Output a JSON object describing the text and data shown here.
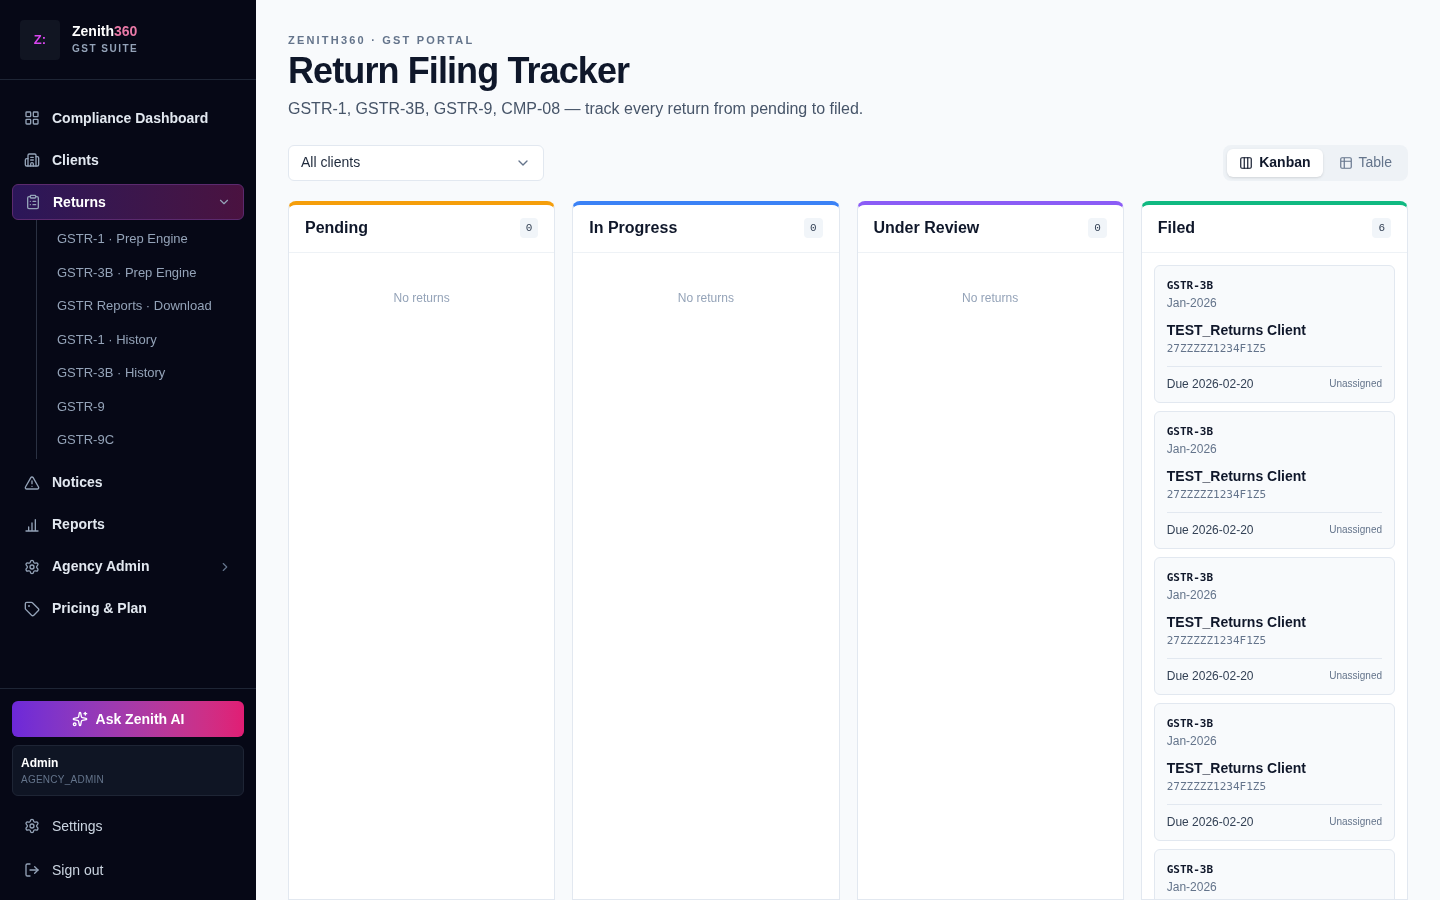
{
  "brand": {
    "logo": "Z:",
    "name": "Zenith",
    "name_accent": "360",
    "tagline": "GST SUITE"
  },
  "nav": [
    {
      "label": "Compliance Dashboard",
      "selected": false
    },
    {
      "label": "Clients",
      "selected": false
    },
    {
      "label": "Returns",
      "selected": true,
      "expanded": true,
      "children": [
        {
          "label": "GSTR-1 · Prep Engine"
        },
        {
          "label": "GSTR-3B · Prep Engine"
        },
        {
          "label": "GSTR Reports · Download"
        },
        {
          "label": "GSTR-1 · History"
        },
        {
          "label": "GSTR-3B · History"
        },
        {
          "label": "GSTR-9"
        },
        {
          "label": "GSTR-9C"
        }
      ]
    },
    {
      "label": "Notices",
      "selected": false
    },
    {
      "label": "Reports",
      "selected": false
    },
    {
      "label": "Agency Admin",
      "selected": false,
      "expanded": false
    },
    {
      "label": "Pricing & Plan",
      "selected": false
    }
  ],
  "ai_button": "Ask Zenith AI",
  "user": {
    "name": "Admin",
    "role": "AGENCY_ADMIN"
  },
  "footer_links": [
    {
      "label": "Settings"
    },
    {
      "label": "Sign out"
    }
  ],
  "header": {
    "eyebrow": "ZENITH360 · GST PORTAL",
    "title": "Return Filing Tracker",
    "subtitle": "GSTR-1, GSTR-3B, GSTR-9, CMP-08 — track every return from pending to filed."
  },
  "client_filter": {
    "value": "All clients"
  },
  "view_toggle": [
    {
      "label": "Kanban",
      "selected": true
    },
    {
      "label": "Table",
      "selected": false
    }
  ],
  "columns": [
    {
      "title": "Pending",
      "count": "0",
      "color": "#f59e0b",
      "empty_text": "No returns"
    },
    {
      "title": "In Progress",
      "count": "0",
      "color": "#3b82f6",
      "empty_text": "No returns"
    },
    {
      "title": "Under Review",
      "count": "0",
      "color": "#8b5cf6",
      "empty_text": "No returns"
    },
    {
      "title": "Filed",
      "count": "6",
      "color": "#10b981",
      "cards": [
        {
          "form": "GSTR-3B",
          "period": "Jan-2026",
          "client": "TEST_Returns Client",
          "gstin": "27ZZZZZ1234F1Z5",
          "due": "Due 2026-02-20",
          "assignee": "Unassigned"
        },
        {
          "form": "GSTR-3B",
          "period": "Jan-2026",
          "client": "TEST_Returns Client",
          "gstin": "27ZZZZZ1234F1Z5",
          "due": "Due 2026-02-20",
          "assignee": "Unassigned"
        },
        {
          "form": "GSTR-3B",
          "period": "Jan-2026",
          "client": "TEST_Returns Client",
          "gstin": "27ZZZZZ1234F1Z5",
          "due": "Due 2026-02-20",
          "assignee": "Unassigned"
        },
        {
          "form": "GSTR-3B",
          "period": "Jan-2026",
          "client": "TEST_Returns Client",
          "gstin": "27ZZZZZ1234F1Z5",
          "due": "Due 2026-02-20",
          "assignee": "Unassigned"
        },
        {
          "form": "GSTR-3B",
          "period": "Jan-2026"
        }
      ]
    }
  ]
}
